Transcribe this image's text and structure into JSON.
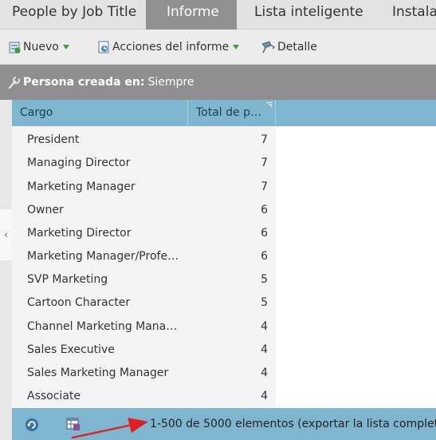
{
  "tabs": [
    {
      "label": "People by Job Title",
      "active": false
    },
    {
      "label": "Informe",
      "active": true
    },
    {
      "label": "Lista inteligente",
      "active": false
    },
    {
      "label": "Instala",
      "active": false
    }
  ],
  "toolbar": {
    "new_label": "Nuevo",
    "actions_label": "Acciones del informe",
    "detail_label": "Detalle"
  },
  "filter": {
    "label": "Persona creada en:",
    "value": "Siempre"
  },
  "collapse_glyph": "‹",
  "grid": {
    "columns": [
      "Cargo",
      "Total de p…"
    ],
    "rows": [
      {
        "cargo": "President",
        "total": "7"
      },
      {
        "cargo": "Managing Director",
        "total": "7"
      },
      {
        "cargo": "Marketing Manager",
        "total": "7"
      },
      {
        "cargo": "Owner",
        "total": "6"
      },
      {
        "cargo": "Marketing Director",
        "total": "6"
      },
      {
        "cargo": "Marketing Manager/Profes…",
        "total": "6"
      },
      {
        "cargo": "SVP Marketing",
        "total": "5"
      },
      {
        "cargo": "Cartoon Character",
        "total": "5"
      },
      {
        "cargo": "Channel Marketing Manager",
        "total": "4"
      },
      {
        "cargo": "Sales Executive",
        "total": "4"
      },
      {
        "cargo": "Sales Marketing Manager",
        "total": "4"
      },
      {
        "cargo": "Associate",
        "total": "4"
      }
    ]
  },
  "footer": {
    "range_text": "1-500 de 5000 elementos",
    "export_text": "(exportar la lista completa)"
  },
  "colors": {
    "header_blue": "#7eb6cf",
    "active_tab": "#909090",
    "filter_bar": "#8f8f8f",
    "annotation_arrow": "#e02020"
  },
  "icons": [
    "new-icon",
    "report-actions-icon",
    "detail-icon",
    "wrench-icon",
    "refresh-icon",
    "columns-icon",
    "column-menu-icon"
  ]
}
